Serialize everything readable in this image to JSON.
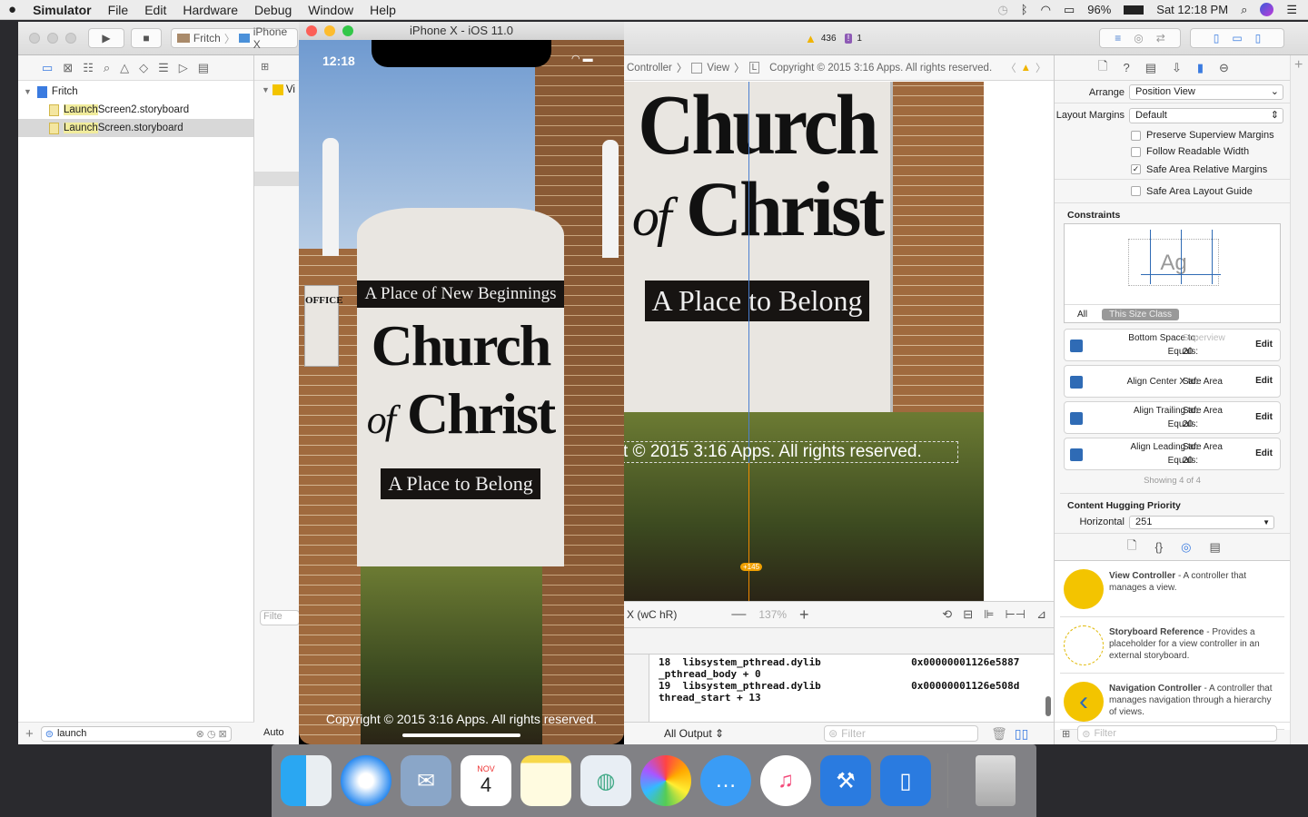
{
  "menubar": {
    "apple": "",
    "app": "Simulator",
    "items": [
      "File",
      "Edit",
      "Hardware",
      "Debug",
      "Window",
      "Help"
    ],
    "battery": "96%",
    "clock": "Sat 12:18 PM"
  },
  "toolbar": {
    "scheme": "Fritch",
    "device": "iPhone X",
    "warnings": "436",
    "issues": "1"
  },
  "navigator": {
    "project": "Fritch",
    "files": [
      {
        "match": "Launch",
        "rest": " Screen2.storyboard"
      },
      {
        "match": "Launch",
        "rest": " Screen.storyboard"
      }
    ],
    "filter": "launch"
  },
  "outline": {
    "item": "Vi",
    "filter_placeholder": "Filte",
    "auto": "Auto"
  },
  "simulator": {
    "title": "iPhone X - iOS 11.0",
    "time": "12:18",
    "label": "Copyright © 2015 3:16 Apps. All rights reserved."
  },
  "photo": {
    "top_plaque": "A Place of New Beginnings",
    "church": "Church",
    "of": "of",
    "christ": "Christ",
    "bottom_plaque": "A Place to Belong",
    "office": "OFFICE"
  },
  "jumpbar": {
    "items": [
      "Controller",
      "View",
      "L"
    ],
    "label": "Copyright © 2015 3:16 Apps. All rights reserved."
  },
  "canvas": {
    "overlay_label": "t © 2015 3:16 Apps. All rights reserved.",
    "badge": "+145",
    "size_class": "X (wC hR)",
    "zoom": "137%"
  },
  "console": {
    "lines": [
      "18  libsystem_pthread.dylib               0x00000001126e5887",
      "_pthread_body + 0",
      "19  libsystem_pthread.dylib               0x00000001126e508d",
      "thread_start + 13"
    ],
    "output": "All Output ⇕",
    "filter": "Filter"
  },
  "inspector": {
    "arrange_label": "Arrange",
    "arrange": "Position View",
    "margins_label": "Layout Margins",
    "margins": "Default",
    "checks": [
      {
        "label": "Preserve Superview Margins",
        "checked": false
      },
      {
        "label": "Follow Readable Width",
        "checked": false
      },
      {
        "label": "Safe Area Relative Margins",
        "checked": true
      },
      {
        "label": "Safe Area Layout Guide",
        "checked": false
      }
    ],
    "constraints_title": "Constraints",
    "preview": "Ag",
    "tab_all": "All",
    "tab_size": "This Size Class",
    "constraints": [
      {
        "label": "Bottom Space to:",
        "target": "Superview",
        "equals_label": "Equals:",
        "equals": "20"
      },
      {
        "label": "Align Center X to:",
        "target": "Safe Area"
      },
      {
        "label": "Align Trailing to:",
        "target": "Safe Area",
        "equals_label": "Equals:",
        "equals": "20"
      },
      {
        "label": "Align Leading to:",
        "target": "Safe Area",
        "equals_label": "Equals:",
        "equals": "20"
      }
    ],
    "edit": "Edit",
    "showing": "Showing 4 of 4",
    "hugging_title": "Content Hugging Priority",
    "horizontal_label": "Horizontal",
    "horizontal": "251"
  },
  "library": {
    "items": [
      {
        "name": "View Controller",
        "desc": " - A controller that manages a view."
      },
      {
        "name": "Storyboard Reference",
        "desc": " - Provides a placeholder for a view controller in an external storyboard."
      },
      {
        "name": "Navigation Controller",
        "desc": " - A controller that manages navigation through a hierarchy of views."
      }
    ],
    "filter": "Filter"
  },
  "dock": {
    "calendar_month": "NOV",
    "calendar_day": "4"
  }
}
